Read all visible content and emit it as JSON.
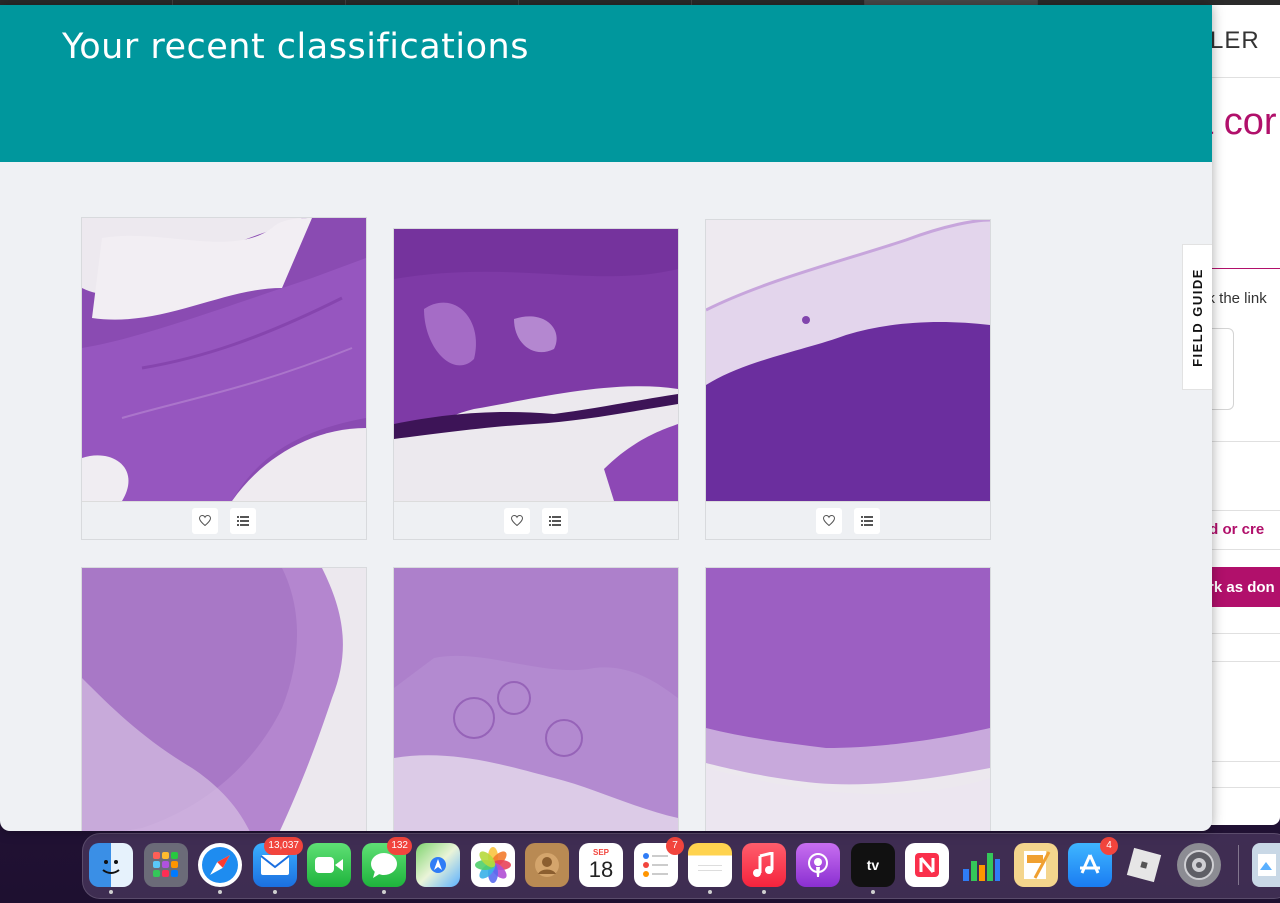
{
  "modal": {
    "title": "Your recent classifications",
    "header_color": "#00979d"
  },
  "field_guide": {
    "label": "FIELD GUIDE"
  },
  "background_page": {
    "partial_title": "LER",
    "partial_heading": "a cor",
    "partial_help": "ck the link",
    "partial_add_link": "dd or cre",
    "partial_done_button": "rk as don",
    "accent_color": "#b1106b"
  },
  "classifications": [
    {
      "thumbnail": "histology-slide-1",
      "favorite_icon": "heart-icon",
      "collect_icon": "list-icon"
    },
    {
      "thumbnail": "histology-slide-2",
      "favorite_icon": "heart-icon",
      "collect_icon": "list-icon"
    },
    {
      "thumbnail": "histology-slide-3",
      "favorite_icon": "heart-icon",
      "collect_icon": "list-icon"
    },
    {
      "thumbnail": "histology-slide-4"
    },
    {
      "thumbnail": "histology-slide-5"
    },
    {
      "thumbnail": "histology-slide-6"
    }
  ],
  "dock": {
    "items": [
      {
        "name": "Finder",
        "icon": "finder-icon",
        "running": true
      },
      {
        "name": "Launchpad",
        "icon": "launchpad-icon",
        "running": false
      },
      {
        "name": "Safari",
        "icon": "safari-icon",
        "running": true
      },
      {
        "name": "Mail",
        "icon": "mail-icon",
        "badge": "13,037",
        "running": true
      },
      {
        "name": "FaceTime",
        "icon": "facetime-icon",
        "running": false
      },
      {
        "name": "Messages",
        "icon": "messages-icon",
        "badge": "132",
        "running": true
      },
      {
        "name": "Maps",
        "icon": "maps-icon",
        "running": false
      },
      {
        "name": "Photos",
        "icon": "photos-icon",
        "running": false
      },
      {
        "name": "Contacts",
        "icon": "contacts-icon",
        "running": false
      },
      {
        "name": "Calendar",
        "icon": "calendar-icon",
        "month": "SEP",
        "day": "18",
        "running": false
      },
      {
        "name": "Reminders",
        "icon": "reminders-icon",
        "badge": "7",
        "running": false
      },
      {
        "name": "Notes",
        "icon": "notes-icon",
        "running": true
      },
      {
        "name": "Music",
        "icon": "music-icon",
        "running": true
      },
      {
        "name": "Podcasts",
        "icon": "podcasts-icon",
        "running": false
      },
      {
        "name": "TV",
        "icon": "tv-icon",
        "label": "tv",
        "running": true
      },
      {
        "name": "News",
        "icon": "news-icon",
        "running": false
      },
      {
        "name": "Numbers",
        "icon": "numbers-icon",
        "running": false
      },
      {
        "name": "Pages",
        "icon": "pages-icon",
        "running": false
      },
      {
        "name": "App Store",
        "icon": "app-store-icon",
        "badge": "4",
        "running": false
      },
      {
        "name": "Roblox",
        "icon": "roblox-icon",
        "running": false
      },
      {
        "name": "System Settings",
        "icon": "system-settings-icon",
        "running": false
      },
      {
        "name": "Preview",
        "icon": "preview-icon",
        "running": false
      }
    ]
  }
}
